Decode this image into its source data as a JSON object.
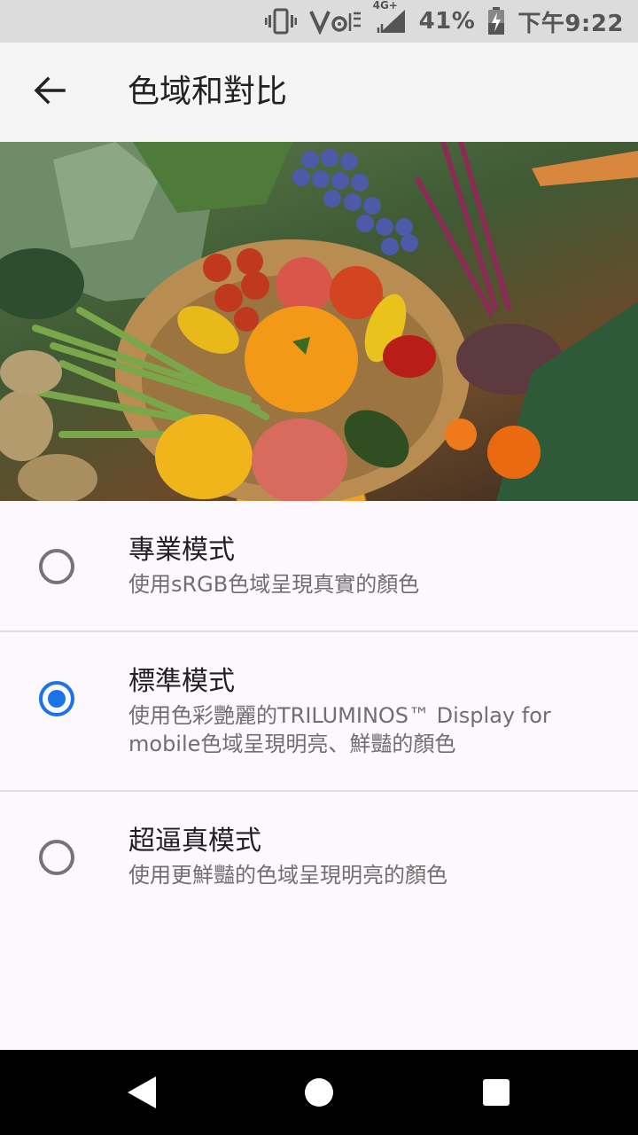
{
  "status_bar": {
    "battery_percent": "41%",
    "clock": "下午9:22",
    "network_label": "4G+",
    "icons": [
      "vibrate-icon",
      "volte-wifi-icon",
      "signal-icon",
      "battery-charging-icon"
    ]
  },
  "app_bar": {
    "back_icon": "arrow-back-icon",
    "title": "色域和對比"
  },
  "options": [
    {
      "title": "專業模式",
      "subtitle": "使用sRGB色域呈現真實的顏色",
      "selected": false
    },
    {
      "title": "標準模式",
      "subtitle": "使用色彩艷麗的TRILUMINOS™ Display for mobile色域呈現明亮、鮮豔的顏色",
      "selected": true
    },
    {
      "title": "超逼真模式",
      "subtitle": "使用更鮮豔的色域呈現明亮的顏色",
      "selected": false
    }
  ],
  "nav_bar": {
    "icons": [
      "back-triangle-icon",
      "home-circle-icon",
      "recents-square-icon"
    ]
  },
  "colors": {
    "accent": "#1a73e8",
    "status_bar_bg": "#dcdcdc",
    "app_bar_bg": "#f5f5f5",
    "page_bg": "#fdf8fd"
  }
}
